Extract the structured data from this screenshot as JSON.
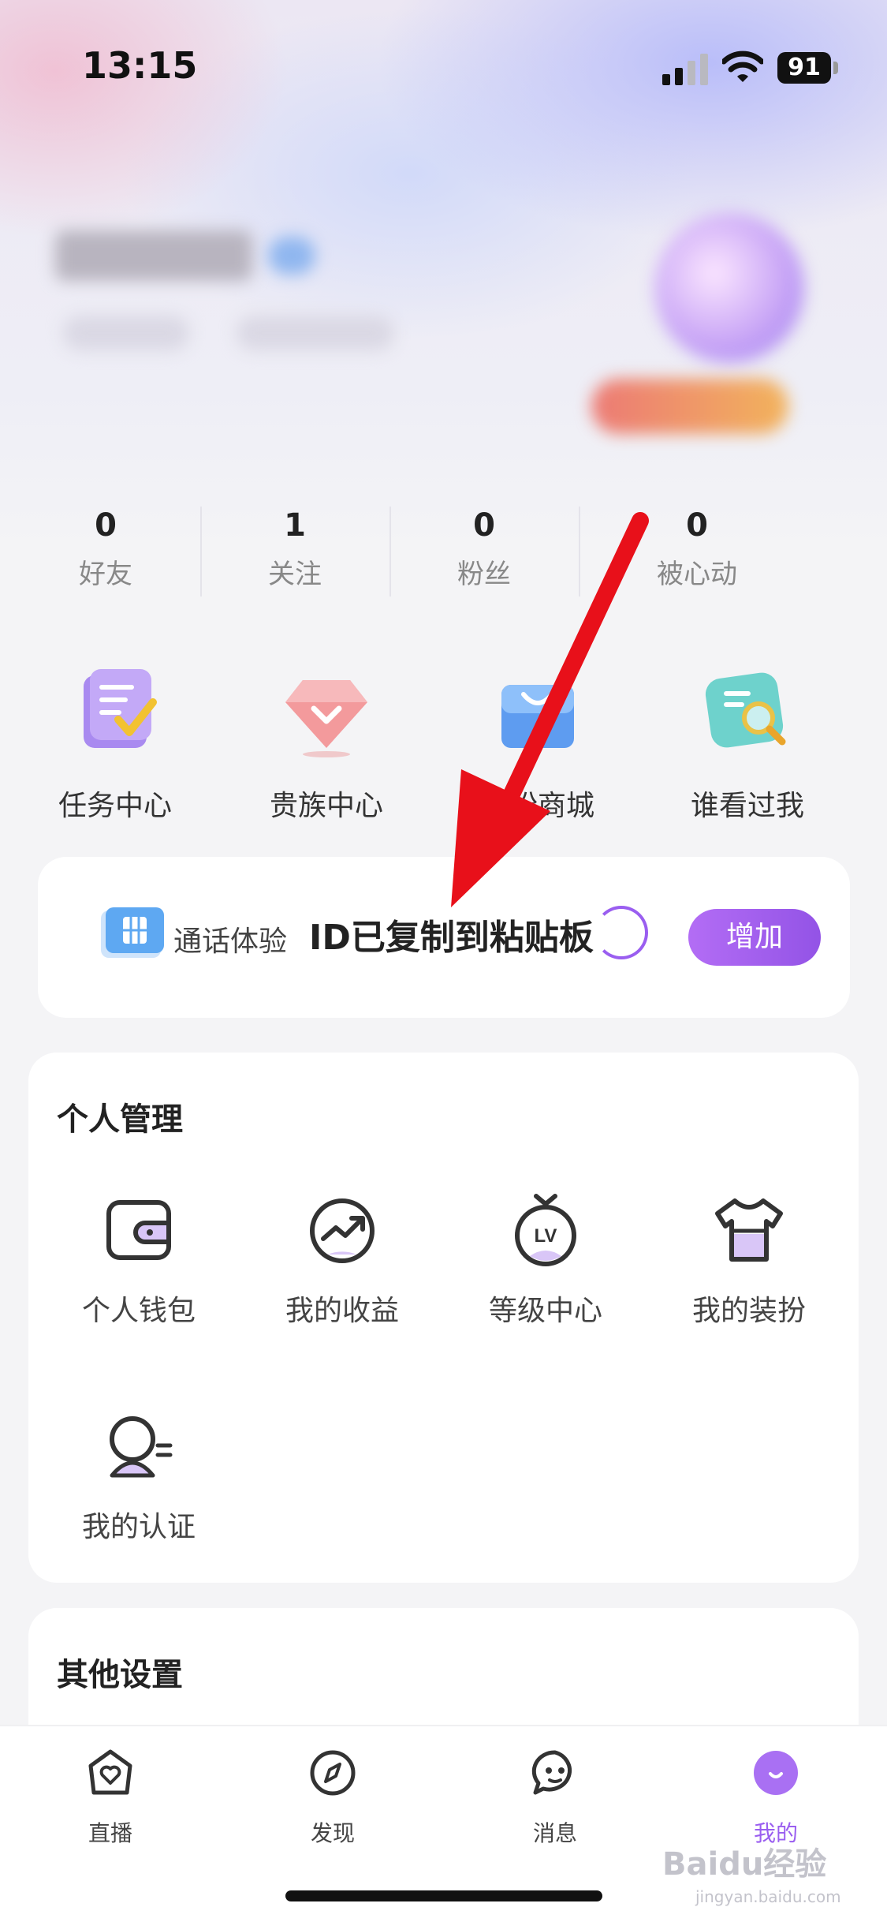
{
  "status_bar": {
    "time": "13:15",
    "battery": "91"
  },
  "stats": [
    {
      "value": "0",
      "label": "好友"
    },
    {
      "value": "1",
      "label": "关注"
    },
    {
      "value": "0",
      "label": "粉丝"
    },
    {
      "value": "0",
      "label": "被心动"
    }
  ],
  "quick_actions": [
    {
      "label": "任务中心",
      "icon": "task-center-icon"
    },
    {
      "label": "贵族中心",
      "icon": "noble-diamond-icon"
    },
    {
      "label": "装扮商城",
      "icon": "shop-bag-icon"
    },
    {
      "label": "谁看过我",
      "icon": "visitor-search-icon"
    }
  ],
  "call_card": {
    "label": "通话体验",
    "toast": "ID已复制到粘贴板",
    "add_button": "增加"
  },
  "personal_management": {
    "title": "个人管理",
    "items": [
      {
        "label": "个人钱包",
        "icon": "wallet-icon"
      },
      {
        "label": "我的收益",
        "icon": "earnings-chart-icon"
      },
      {
        "label": "等级中心",
        "icon": "level-lv-icon"
      },
      {
        "label": "我的装扮",
        "icon": "outfit-shirt-icon"
      },
      {
        "label": "我的认证",
        "icon": "verification-user-icon"
      }
    ]
  },
  "other_settings": {
    "title": "其他设置"
  },
  "tabbar": {
    "items": [
      {
        "label": "直播",
        "icon": "live-heart-house-icon",
        "active": false
      },
      {
        "label": "发现",
        "icon": "compass-icon",
        "active": false
      },
      {
        "label": "消息",
        "icon": "chat-face-icon",
        "active": false
      },
      {
        "label": "我的",
        "icon": "profile-smile-icon",
        "active": true
      }
    ]
  },
  "colors": {
    "accent": "#9a5ef0",
    "annotation_arrow": "#e8101a"
  },
  "watermark": {
    "text": "Baidu经验",
    "sub": "jingyan.baidu.com"
  }
}
